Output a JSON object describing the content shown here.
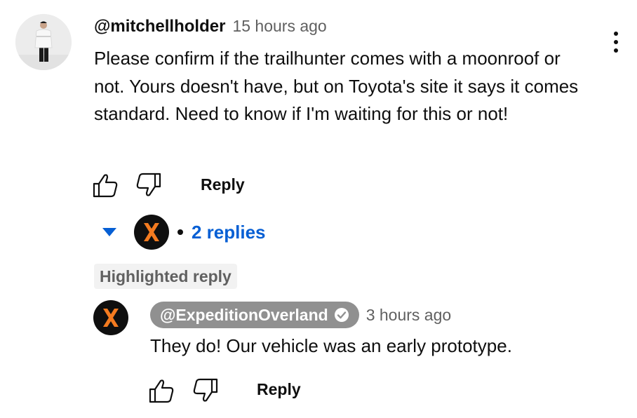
{
  "comment": {
    "author": "@mitchellholder",
    "time": "15 hours ago",
    "text": "Please confirm if the trailhunter comes with a moonroof or not. Yours doesn't have, but on Toyota's site it says it comes standard. Need to know if I'm waiting for this or not!",
    "reply_label": "Reply",
    "icons": {
      "like": "thumbs-up-icon",
      "dislike": "thumbs-down-icon",
      "more": "more-vert-icon"
    }
  },
  "replies_toggle": {
    "count_label": "2 replies",
    "accent_color": "#065fd4"
  },
  "highlighted_badge": "Highlighted reply",
  "reply": {
    "author": "@ExpeditionOverland",
    "time": "3 hours ago",
    "text": "They do! Our vehicle was an early prototype.",
    "reply_label": "Reply",
    "brand_color": "#f47b20"
  }
}
